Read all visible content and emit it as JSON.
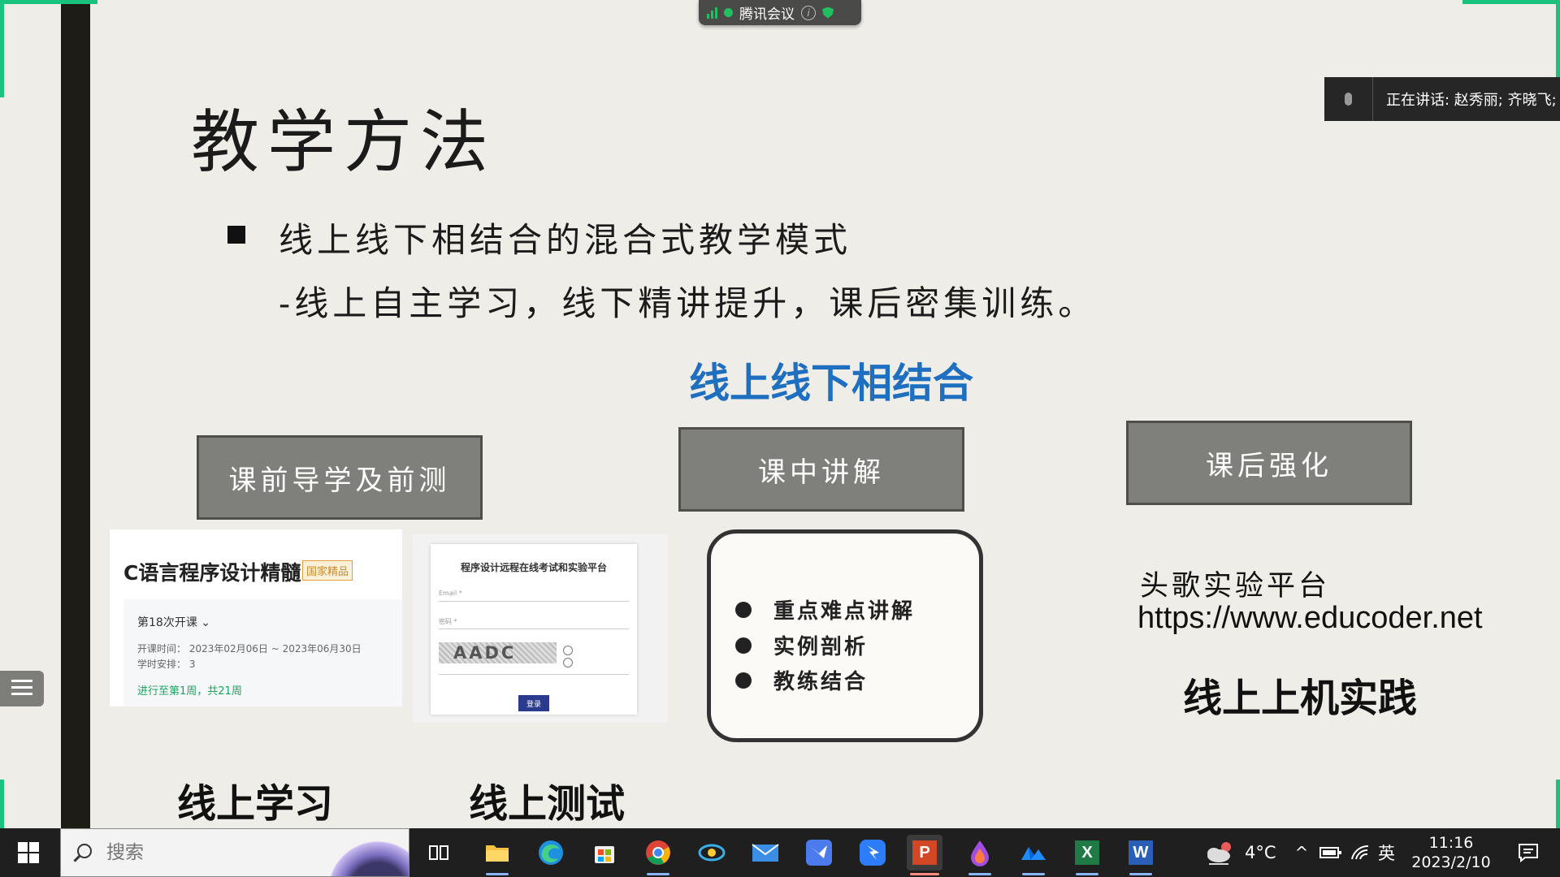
{
  "meeting": {
    "app_name": "腾讯会议",
    "info_glyph": "i"
  },
  "speaker": {
    "text": "正在讲话: 赵秀丽; 齐晓飞;"
  },
  "slide": {
    "title": "教学方法",
    "bullet_line1": "线上线下相结合的混合式教学模式",
    "bullet_line2": "-线上自主学习，线下精讲提升，课后密集训练。",
    "blue_heading": "线上线下相结合",
    "box_pre": "课前导学及前测",
    "box_mid": "课中讲解",
    "box_post": "课后强化",
    "course_card": {
      "title": "C语言程序设计精髓",
      "badge": "国家精品",
      "session": "第18次开课",
      "time": "开课时间：  2023年02月06日 ~ 2023年06月30日",
      "hours": "学时安排：  3",
      "progress": "进行至第1周，共21周"
    },
    "exam_card": {
      "title": "程序设计远程在线考试和实验平台",
      "email_label": "Email *",
      "password_label": "密码 *",
      "captcha": "AADC",
      "login_button": "登录"
    },
    "lecture_items": [
      "重点难点讲解",
      "实例剖析",
      "教练结合"
    ],
    "educoder_name": "头歌实验平台",
    "educoder_url": "https://www.educoder.net",
    "caption_practice": "线上上机实践",
    "caption_learning": "线上学习",
    "caption_test": "线上测试"
  },
  "taskbar": {
    "search_placeholder": "搜索",
    "ppt_glyph": "P",
    "excel_glyph": "X",
    "word_glyph": "W",
    "weather_temp": "4°C",
    "caret": "^",
    "ime": "英",
    "time": "11:16",
    "date": "2023/2/10"
  },
  "colors": {
    "accent_blue": "#1f6fc0",
    "corner_green": "#19c37d",
    "box_gray": "#7f7f7b",
    "taskbar_bg": "#1f1f1f"
  }
}
